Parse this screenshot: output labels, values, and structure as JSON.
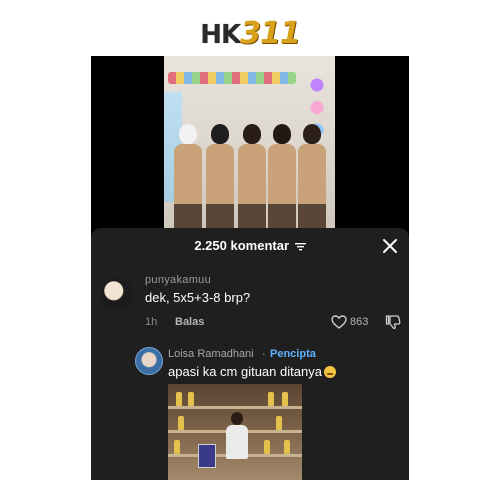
{
  "watermark": {
    "prefix": "HK",
    "number": "311"
  },
  "comments_sheet": {
    "title": "2.250 komentar",
    "sort_icon": "sort-lines-icon",
    "close_icon": "close-icon"
  },
  "comment": {
    "username": "punyakamuu",
    "text": "dek, 5x5+3-8 brp?",
    "time": "1h",
    "reply_label": "Balas",
    "likes": "863"
  },
  "reply": {
    "username": "Loisa Ramadhani",
    "separator": "·",
    "creator_badge": "Pencipta",
    "text": "apasi ka cm gituan ditanya",
    "emoji": "weary-face-emoji"
  }
}
